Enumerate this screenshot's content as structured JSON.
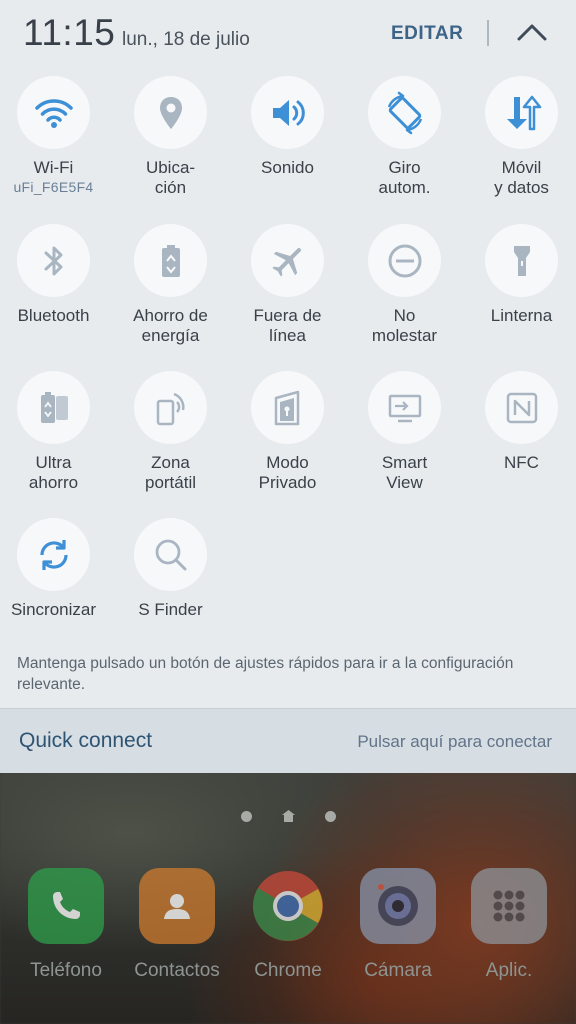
{
  "header": {
    "time": "11:15",
    "date": "lun., 18 de julio",
    "edit_label": "EDITAR"
  },
  "tiles": [
    {
      "label": "Wi-Fi",
      "sub": "uFi_F6E5F4",
      "icon": "wifi-icon",
      "active": true
    },
    {
      "label": "Ubica-\nción",
      "icon": "location-icon",
      "active": false
    },
    {
      "label": "Sonido",
      "icon": "sound-icon",
      "active": true
    },
    {
      "label": "Giro\nautom.",
      "icon": "auto-rotate-icon",
      "active": true
    },
    {
      "label": "Móvil\ny datos",
      "icon": "mobile-data-icon",
      "active": true
    },
    {
      "label": "Bluetooth",
      "icon": "bluetooth-icon",
      "active": false
    },
    {
      "label": "Ahorro de\nenergía",
      "icon": "power-saving-icon",
      "active": false
    },
    {
      "label": "Fuera de\nlínea",
      "icon": "airplane-icon",
      "active": false
    },
    {
      "label": "No\nmolestar",
      "icon": "do-not-disturb-icon",
      "active": false
    },
    {
      "label": "Linterna",
      "icon": "flashlight-icon",
      "active": false
    },
    {
      "label": "Ultra\nahorro",
      "icon": "ultra-power-saving-icon",
      "active": false
    },
    {
      "label": "Zona\nportátil",
      "icon": "hotspot-icon",
      "active": false
    },
    {
      "label": "Modo\nPrivado",
      "icon": "private-mode-icon",
      "active": false
    },
    {
      "label": "Smart\nView",
      "icon": "smart-view-icon",
      "active": false
    },
    {
      "label": "NFC",
      "icon": "nfc-icon",
      "active": false
    },
    {
      "label": "Sincronizar",
      "icon": "sync-icon",
      "active": true
    },
    {
      "label": "S Finder",
      "icon": "search-icon",
      "active": false
    }
  ],
  "hint": "Mantenga pulsado un botón de ajustes rápidos para ir a la configuración relevante.",
  "quick_connect": {
    "title": "Quick connect",
    "action": "Pulsar aquí para conectar"
  },
  "dock": [
    {
      "label": "Teléfono",
      "icon": "phone-icon",
      "color": "#2e9b4a"
    },
    {
      "label": "Contactos",
      "icon": "contacts-icon",
      "color": "#c9782e"
    },
    {
      "label": "Chrome",
      "icon": "chrome-icon",
      "color": "#dd4b39"
    },
    {
      "label": "Cámara",
      "icon": "camera-icon",
      "color": "#7e8aa8"
    },
    {
      "label": "Aplic.",
      "icon": "apps-icon",
      "color": "#8c9096"
    }
  ],
  "colors": {
    "active_icon": "#3d8fd6",
    "inactive_icon": "#a9b6c2",
    "panel_bg": "#e7ebee"
  }
}
